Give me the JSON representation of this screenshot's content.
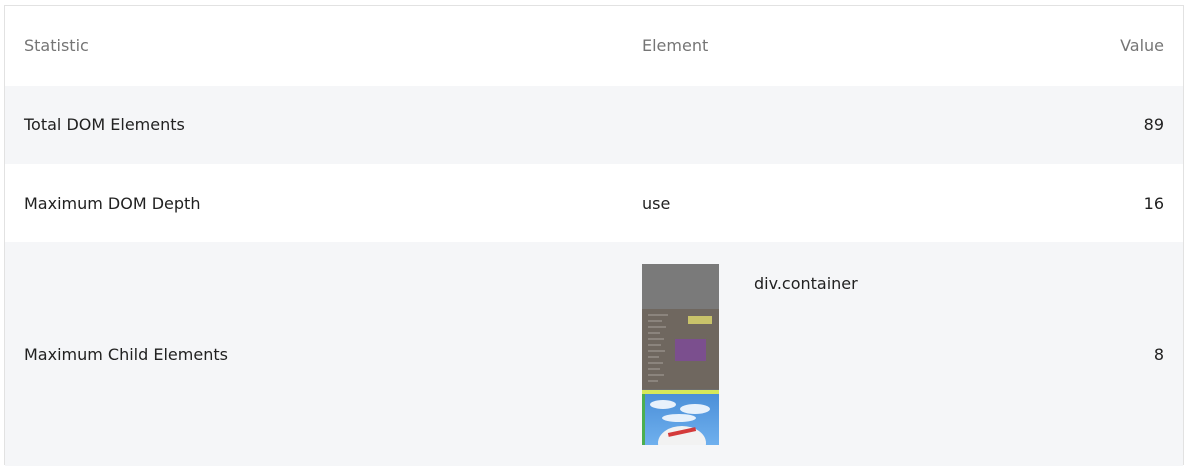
{
  "table": {
    "headers": {
      "statistic": "Statistic",
      "element": "Element",
      "value": "Value"
    },
    "rows": [
      {
        "statistic": "Total DOM Elements",
        "element": "",
        "value": "89"
      },
      {
        "statistic": "Maximum DOM Depth",
        "element": "use",
        "value": "16"
      },
      {
        "statistic": "Maximum Child Elements",
        "element": "div.container",
        "value": "8"
      }
    ]
  },
  "colors": {
    "row_alt_background": "#f5f6f8",
    "header_text": "#757575",
    "body_text": "#212121",
    "border": "#e2e2e2"
  }
}
